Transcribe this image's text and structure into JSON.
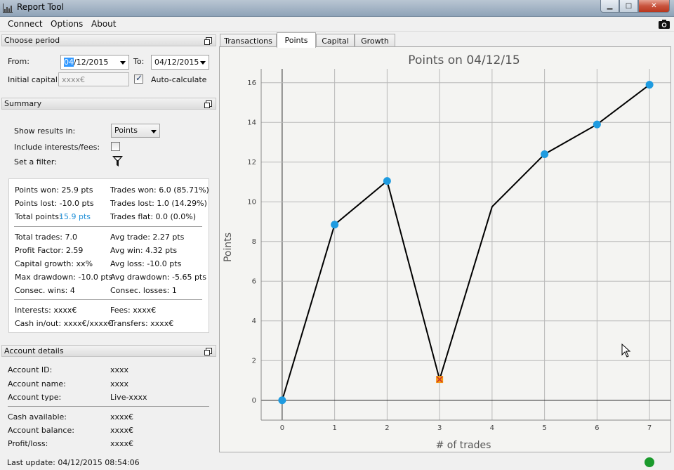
{
  "window": {
    "title": "Report Tool",
    "minimize": "▁",
    "maximize": "□",
    "close": "✕"
  },
  "menu": {
    "items": [
      "Connect",
      "Options",
      "About"
    ]
  },
  "period": {
    "header": "Choose period",
    "from_label": "From:",
    "from_value_sel": "04",
    "from_value_rest": "/12/2015",
    "to_label": "To:",
    "to_value": "04/12/2015",
    "capital_label": "Initial capital:",
    "capital_placeholder": "xxxx€",
    "auto_label": "Auto-calculate"
  },
  "summary": {
    "header": "Summary",
    "show_label": "Show results in:",
    "show_value": "Points",
    "interest_label": "Include interests/fees:",
    "filter_label": "Set a filter:",
    "stats_left": [
      "Points won: 25.9 pts",
      "Points lost: -10.0 pts",
      "Total points: ",
      "Total trades: 7.0",
      "Profit Factor: 2.59",
      "Capital growth: xx%",
      "Max drawdown: -10.0 pts",
      "Consec. wins: 4",
      "Interests: xxxx€",
      "Cash in/out: xxxx€/xxxx€"
    ],
    "total_points_value": "15.9 pts",
    "stats_right": [
      "Trades won: 6.0 (85.71%)",
      "Trades lost: 1.0 (14.29%)",
      "Trades flat: 0.0 (0.0%)",
      "Avg trade: 2.27 pts",
      "Avg win: 4.32 pts",
      "Avg loss: -10.0 pts",
      "Avg drawdown: -5.65 pts",
      "Consec. losses: 1",
      "Fees: xxxx€",
      "Transfers: xxxx€"
    ]
  },
  "account": {
    "header": "Account details",
    "rows": [
      {
        "label": "Account ID:",
        "value": "xxxx"
      },
      {
        "label": "Account name:",
        "value": "xxxx"
      },
      {
        "label": "Account type:",
        "value": "Live-xxxx"
      },
      {
        "label": "Cash available:",
        "value": "xxxx€"
      },
      {
        "label": "Account balance:",
        "value": "xxxx€"
      },
      {
        "label": "Profit/loss:",
        "value": "xxxx€"
      }
    ]
  },
  "status": {
    "last_update": "Last update: 04/12/2015 08:54:06"
  },
  "tabs": [
    "Transactions",
    "Points",
    "Capital",
    "Growth"
  ],
  "colors": {
    "point": "#1e9be0",
    "loss_marker": "#f39c12",
    "loss_cross": "#d0302a",
    "line": "#000000",
    "status_led": "#1a9a2c"
  },
  "chart_data": {
    "type": "line",
    "title": "Points on 04/12/15",
    "xlabel": "# of trades",
    "ylabel": "Points",
    "xlim": [
      -0.4,
      7.4
    ],
    "ylim": [
      -1,
      16.7
    ],
    "xticks": [
      0,
      1,
      2,
      3,
      4,
      5,
      6,
      7
    ],
    "yticks": [
      0,
      2,
      4,
      6,
      8,
      10,
      12,
      14,
      16
    ],
    "grid": true,
    "series": [
      {
        "x": [
          0,
          1,
          2,
          3,
          4,
          5,
          6,
          7
        ],
        "y": [
          0,
          8.85,
          11.05,
          1.05,
          9.75,
          12.4,
          13.9,
          15.9
        ],
        "markers": [
          "win",
          "win",
          "win",
          "loss",
          "none",
          "win",
          "win",
          "win"
        ]
      }
    ]
  }
}
